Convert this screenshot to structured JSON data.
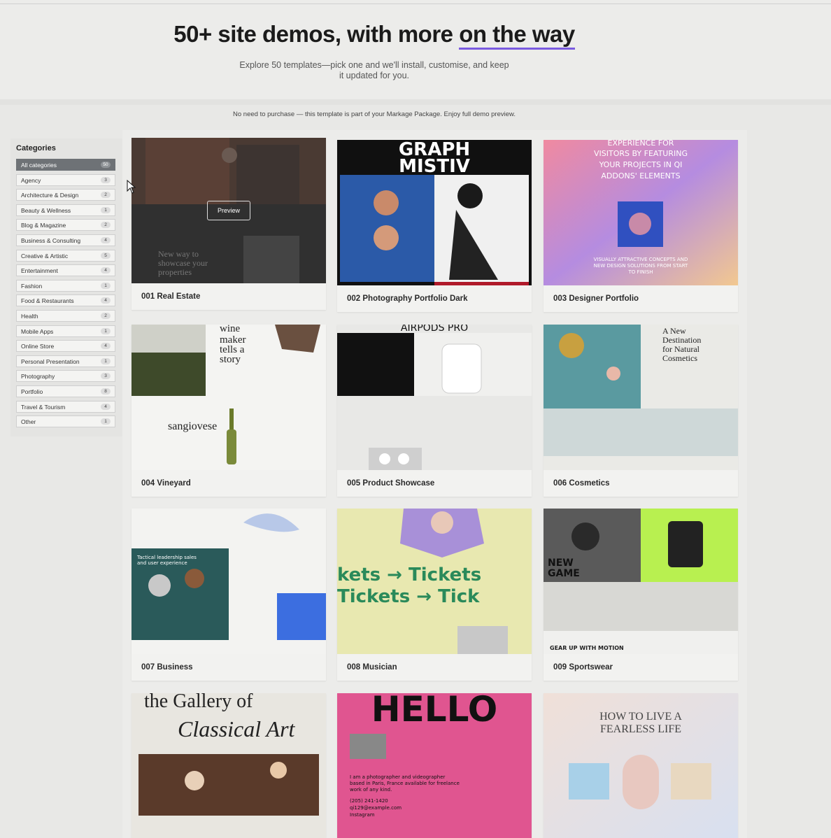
{
  "hero": {
    "title_main": "50+ site demos, with more ",
    "title_underline": "on the way",
    "subtitle": "Explore 50 templates—pick one and we'll install, customise, and keep it updated for you."
  },
  "notice": "No need to purchase — this template is part of your Markage Package. Enjoy full demo preview.",
  "sidebar": {
    "heading": "Categories",
    "items": [
      {
        "label": "All categories",
        "count": "50",
        "active": true
      },
      {
        "label": "Agency",
        "count": "3"
      },
      {
        "label": "Architecture & Design",
        "count": "2"
      },
      {
        "label": "Beauty & Wellness",
        "count": "1"
      },
      {
        "label": "Blog & Magazine",
        "count": "2"
      },
      {
        "label": "Business & Consulting",
        "count": "4"
      },
      {
        "label": "Creative & Artistic",
        "count": "5"
      },
      {
        "label": "Entertainment",
        "count": "4"
      },
      {
        "label": "Fashion",
        "count": "1"
      },
      {
        "label": "Food & Restaurants",
        "count": "4"
      },
      {
        "label": "Health",
        "count": "2"
      },
      {
        "label": "Mobile Apps",
        "count": "1"
      },
      {
        "label": "Online Store",
        "count": "4"
      },
      {
        "label": "Personal Presentation",
        "count": "1"
      },
      {
        "label": "Photography",
        "count": "3"
      },
      {
        "label": "Portfolio",
        "count": "8"
      },
      {
        "label": "Travel & Tourism",
        "count": "4"
      },
      {
        "label": "Other",
        "count": "1"
      }
    ]
  },
  "demos": [
    {
      "title": "001 Real Estate",
      "preview_label": "Preview",
      "thumb_text": "New way to showcase your properties"
    },
    {
      "title": "002 Photography Portfolio Dark",
      "thumb_text": "GRAPH MISTIV"
    },
    {
      "title": "003 Designer Portfolio",
      "thumb_text": "EXPERIENCE FOR VISITORS BY FEATURING YOUR PROJECTS IN QI ADDONS' ELEMENTS",
      "thumb_sub": "VISUALLY ATTRACTIVE CONCEPTS AND NEW DESIGN SOLUTIONS FROM START TO FINISH"
    },
    {
      "title": "004 Vineyard",
      "thumb_text": "wine maker tells a story",
      "thumb_sub": "sangiovese"
    },
    {
      "title": "005 Product Showcase",
      "thumb_text": "AIRPODS PRO"
    },
    {
      "title": "006 Cosmetics",
      "thumb_text": "A New Destination for Natural Cosmetics"
    },
    {
      "title": "007 Business",
      "thumb_text": "Tactical leadership sales and user experience"
    },
    {
      "title": "008 Musician",
      "thumb_text": "Tickets → Tickets → Tickets"
    },
    {
      "title": "009 Sportswear",
      "thumb_text": "NEW GAME",
      "thumb_sub": "GEAR UP WITH MOTION"
    },
    {
      "title": "",
      "thumb_text": "the Gallery of",
      "thumb_sub": "Classical Art"
    },
    {
      "title": "",
      "thumb_text": "HELLO",
      "thumb_sub": "I am a photographer and videographer based in Paris, France available for freelance work of any kind.",
      "thumb_phone": "(205) 241-1420",
      "thumb_email": "qi129@example.com",
      "thumb_link": "Instagram"
    },
    {
      "title": "",
      "thumb_text": "HOW TO LIVE A FEARLESS LIFE"
    }
  ],
  "colors": {
    "accent": "#7a5be0",
    "active_category": "#6e7276"
  }
}
